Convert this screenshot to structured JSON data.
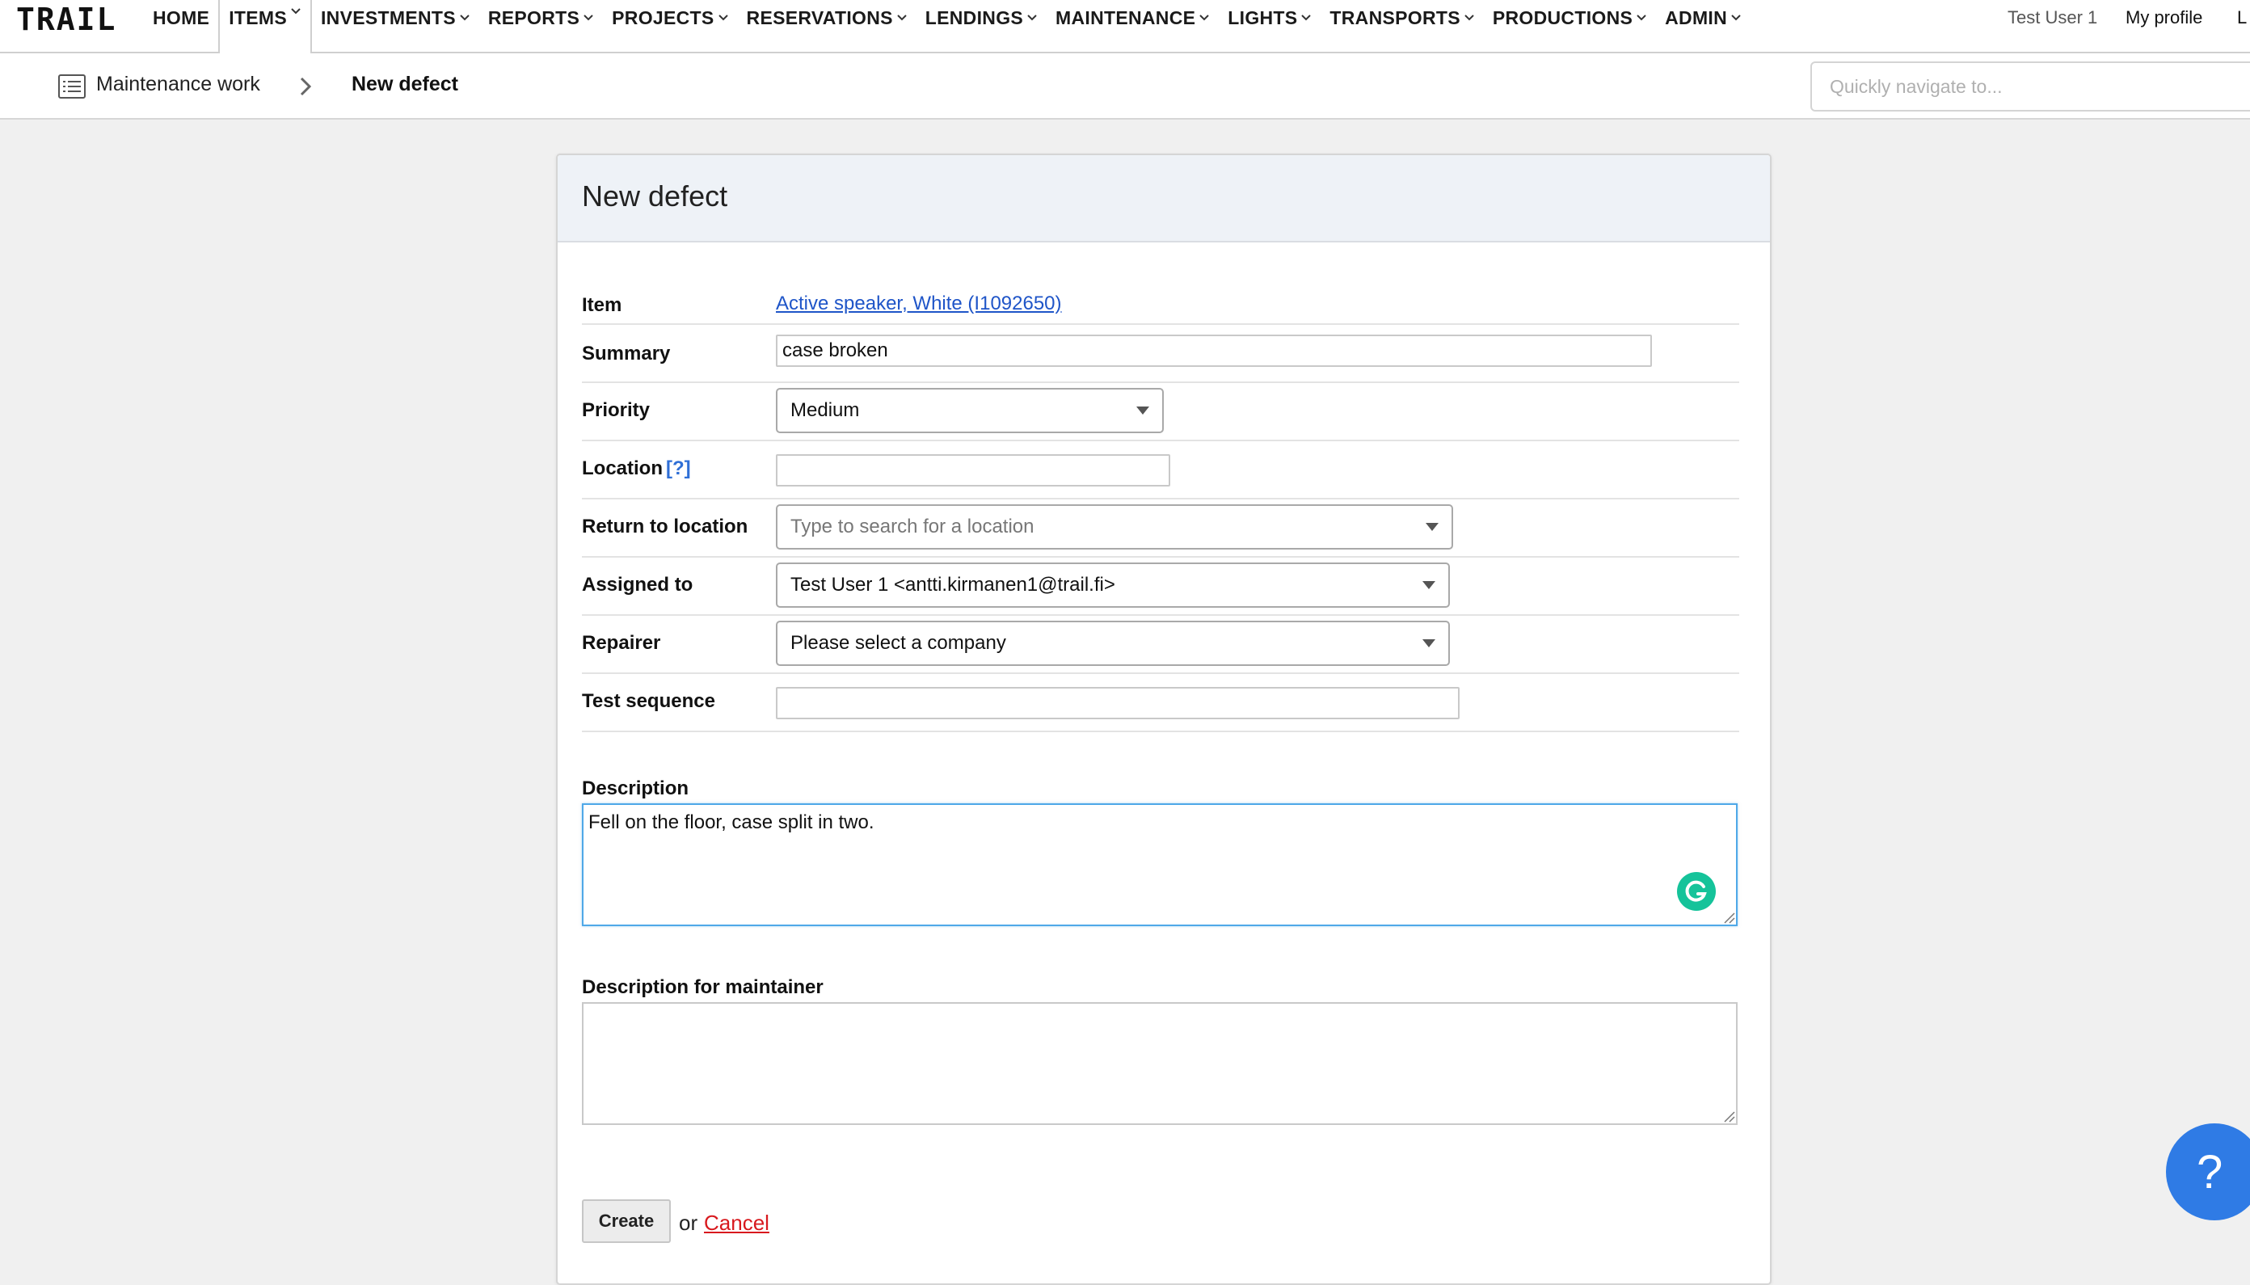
{
  "brand": {
    "logo_text": "TRAIL"
  },
  "nav": {
    "items": [
      {
        "label": "HOME",
        "has_menu": false
      },
      {
        "label": "ITEMS",
        "has_menu": true,
        "active": true
      },
      {
        "label": "INVESTMENTS",
        "has_menu": true
      },
      {
        "label": "REPORTS",
        "has_menu": true
      },
      {
        "label": "PROJECTS",
        "has_menu": true
      },
      {
        "label": "RESERVATIONS",
        "has_menu": true
      },
      {
        "label": "LENDINGS",
        "has_menu": true
      },
      {
        "label": "MAINTENANCE",
        "has_menu": true
      },
      {
        "label": "LIGHTS",
        "has_menu": true
      },
      {
        "label": "TRANSPORTS",
        "has_menu": true
      },
      {
        "label": "PRODUCTIONS",
        "has_menu": true
      },
      {
        "label": "ADMIN",
        "has_menu": true
      }
    ],
    "user_name": "Test User 1",
    "my_profile": "My profile",
    "cut_off_link": "L"
  },
  "breadcrumb": {
    "parent": "Maintenance work",
    "current": "New defect",
    "parent_icon": "list-icon"
  },
  "quick_nav": {
    "placeholder": "Quickly navigate to..."
  },
  "form": {
    "title": "New defect",
    "item": {
      "label": "Item",
      "value": "Active speaker, White (I1092650)"
    },
    "summary": {
      "label": "Summary",
      "value": "case broken"
    },
    "priority": {
      "label": "Priority",
      "value": "Medium"
    },
    "location": {
      "label": "Location",
      "help": "[?]",
      "value": ""
    },
    "return_location": {
      "label": "Return to location",
      "placeholder": "Type to search for a location"
    },
    "assigned_to": {
      "label": "Assigned to",
      "value": "Test User 1 <antti.kirmanen1@trail.fi>"
    },
    "repairer": {
      "label": "Repairer",
      "placeholder": "Please select a company"
    },
    "test_sequence": {
      "label": "Test sequence",
      "value": ""
    },
    "description": {
      "label": "Description",
      "value": "Fell on the floor, case split in two."
    },
    "maintainer_description": {
      "label": "Description for maintainer",
      "value": ""
    },
    "create_label": "Create",
    "or_text": "or",
    "cancel_label": "Cancel"
  },
  "help_fab": {
    "symbol": "?"
  },
  "colors": {
    "link": "#1f55c8",
    "cancel": "#d8191e",
    "focus_border": "#4fa8e8",
    "help_fab": "#2f7be5",
    "card_header": "#eef2f7",
    "grammarly": "#15c39a"
  }
}
